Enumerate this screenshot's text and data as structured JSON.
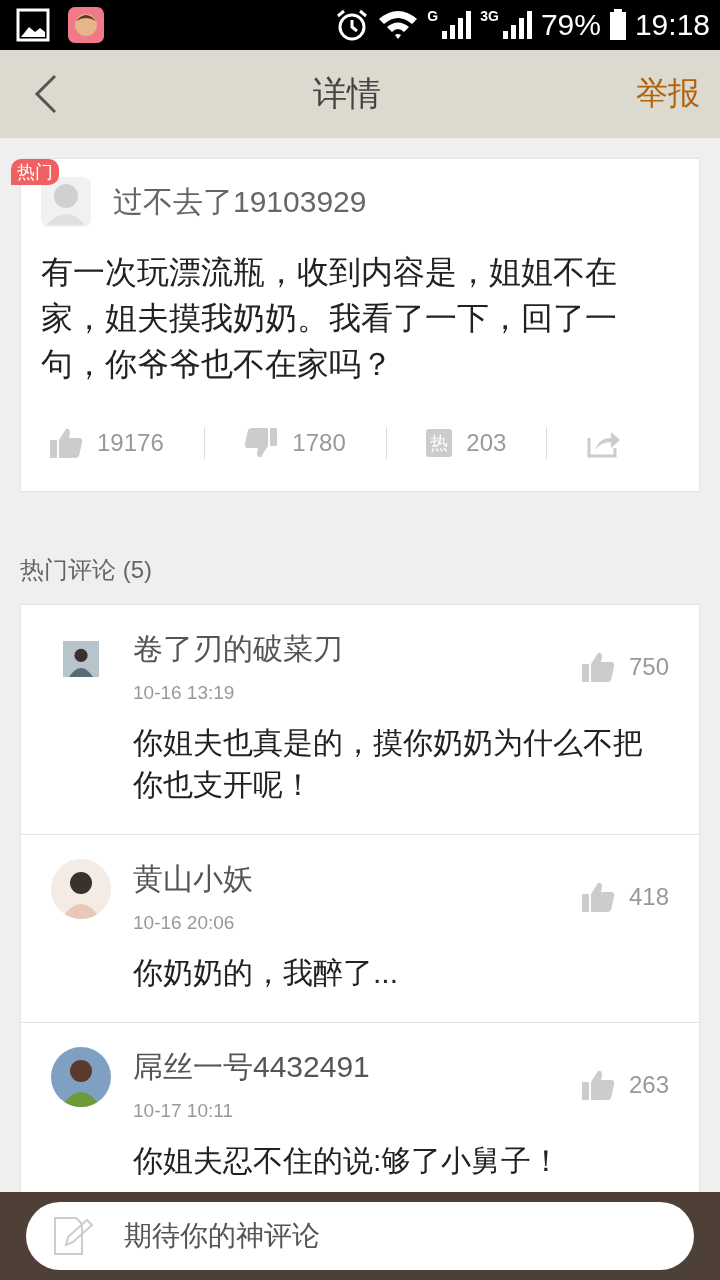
{
  "status_bar": {
    "network_1": "G",
    "network_2": "3G",
    "battery": "79%",
    "time": "19:18"
  },
  "nav": {
    "title": "详情",
    "action": "举报"
  },
  "post": {
    "badge": "热门",
    "author": "过不去了19103929",
    "text": "有一次玩漂流瓶，收到内容是，姐姐不在家，姐夫摸我奶奶。我看了一下，回了一句，你爷爷也不在家吗？",
    "likes": "19176",
    "dislikes": "1780",
    "comment_icon": "热",
    "comments": "203"
  },
  "comments_header": "热门评论 (5)",
  "comments": [
    {
      "name": "卷了刃的破菜刀",
      "time": "10-16 13:19",
      "likes": "750",
      "text": "你姐夫也真是的，摸你奶奶为什么不把你也支开呢！"
    },
    {
      "name": "黄山小妖",
      "time": "10-16 20:06",
      "likes": "418",
      "text": "你奶奶的，我醉了..."
    },
    {
      "name": "屌丝一号4432491",
      "time": "10-17 10:11",
      "likes": "263",
      "text": "你姐夫忍不住的说:够了小舅子！"
    }
  ],
  "composer": {
    "placeholder": "期待你的神评论"
  }
}
